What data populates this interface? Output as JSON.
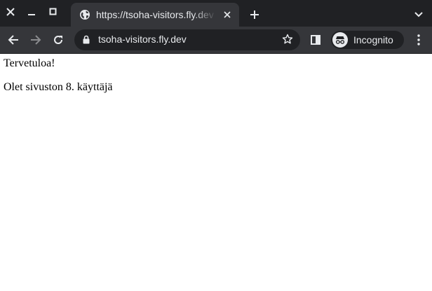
{
  "window_controls": {
    "close_icon": "close-icon",
    "minimize_icon": "minimize-icon",
    "maximize_icon": "maximize-icon"
  },
  "tab": {
    "title": "https://tsoha-visitors.fly.dev",
    "favicon": "globe-icon"
  },
  "toolbar": {
    "url": "tsoha-visitors.fly.dev",
    "incognito_label": "Incognito"
  },
  "colors": {
    "frame": "#202124",
    "toolbar": "#35363a",
    "text_light": "#e8eaed",
    "page_bg": "#ffffff"
  },
  "page": {
    "greeting": "Tervetuloa!",
    "visitor_message": "Olet sivuston 8. käyttäjä"
  }
}
